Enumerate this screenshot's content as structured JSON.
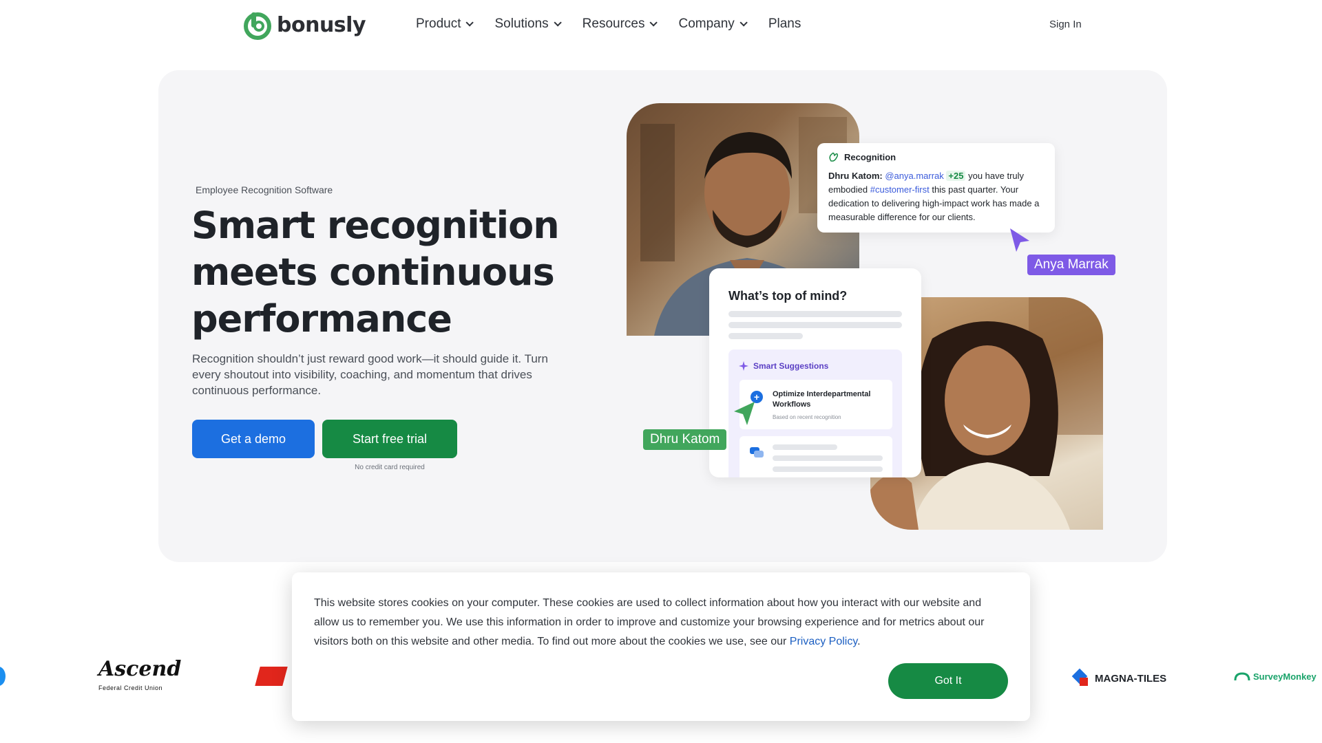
{
  "brand": {
    "name": "bonusly",
    "color": "#41a65c"
  },
  "nav": {
    "items": [
      {
        "label": "Product",
        "has_dropdown": true
      },
      {
        "label": "Solutions",
        "has_dropdown": true
      },
      {
        "label": "Resources",
        "has_dropdown": true
      },
      {
        "label": "Company",
        "has_dropdown": true
      },
      {
        "label": "Plans",
        "has_dropdown": false
      }
    ],
    "sign_in": "Sign In"
  },
  "hero": {
    "eyebrow": "Employee Recognition Software",
    "headline": "Smart recognition meets continuous performance",
    "subcopy": "Recognition shouldn’t just reward good work—it should guide it. Turn every shoutout into visibility, coaching, and momentum that drives continuous performance.",
    "primary_cta": "Get a demo",
    "secondary_cta": "Start free trial",
    "cta_note": "No credit card required"
  },
  "recognition_card": {
    "title": "Recognition",
    "author": "Dhru Katom:",
    "mention": "@anya.marrak",
    "points": "+25",
    "text_1": "you have truly embodied",
    "hashtag": "#customer-first",
    "text_2": "this past quarter. Your dedication to delivering high-impact work has made a measurable difference for our clients."
  },
  "name_tags": {
    "anya": "Anya Marrak",
    "dhru": "Dhru Katom"
  },
  "mind_card": {
    "title": "What’s top of mind?",
    "suggestions_title": "Smart Suggestions",
    "suggestion": "Optimize Interdepartmental Workflows",
    "suggestion_note": "Based on recent recognition"
  },
  "logos": [
    "Ascend",
    "Federal Credit Union",
    "MAGNA-TILES",
    "SurveyMonkey"
  ],
  "cookie": {
    "text": "This website stores cookies on your computer. These cookies are used to collect information about how you interact with our website and allow us to remember you. We use this information in order to improve and customize your browsing experience and for metrics about our visitors both on this website and other media. To find out more about the cookies we use, see our ",
    "link": "Privacy Policy",
    "button": "Got It"
  },
  "colors": {
    "primary_blue": "#1c6fe0",
    "primary_green": "#168a44",
    "accent_purple": "#7e5ae6"
  }
}
